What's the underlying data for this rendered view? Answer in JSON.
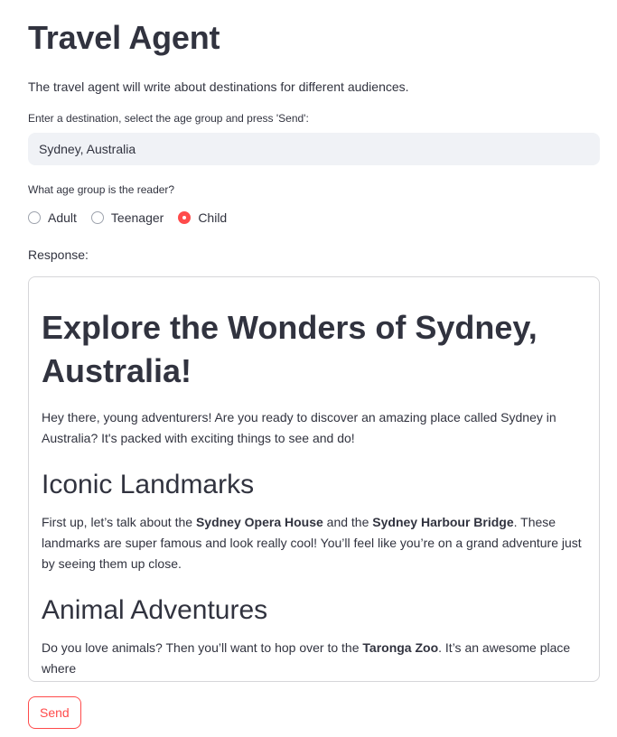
{
  "app": {
    "title": "Travel Agent",
    "description": "The travel agent will write about destinations for different audiences."
  },
  "destination_input": {
    "label": "Enter a destination, select the age group and press 'Send':",
    "value": "Sydney, Australia"
  },
  "age_group": {
    "label": "What age group is the reader?",
    "options": [
      "Adult",
      "Teenager",
      "Child"
    ],
    "selected": "Child"
  },
  "response": {
    "label": "Response:",
    "heading": "Explore the Wonders of Sydney, Australia!",
    "intro": "Hey there, young adventurers! Are you ready to discover an amazing place called Sydney in Australia? It's packed with exciting things to see and do!",
    "section1": {
      "heading": "Iconic Landmarks",
      "text_a": "First up, let’s talk about the ",
      "bold_a": "Sydney Opera House",
      "text_b": " and the ",
      "bold_b": "Sydney Harbour Bridge",
      "text_c": ". These landmarks are super famous and look really cool! You’ll feel like you’re on a grand adventure just by seeing them up close."
    },
    "section2": {
      "heading": "Animal Adventures",
      "text_a": "Do you love animals? Then you’ll want to hop over to the ",
      "bold_a": "Taronga Zoo",
      "text_b": ". It’s an awesome place where"
    }
  },
  "send_button": {
    "label": "Send"
  },
  "colors": {
    "accent": "#ff4b4b",
    "text": "#31333f",
    "input_bg": "#f0f2f6",
    "border": "#d6d6d9"
  }
}
